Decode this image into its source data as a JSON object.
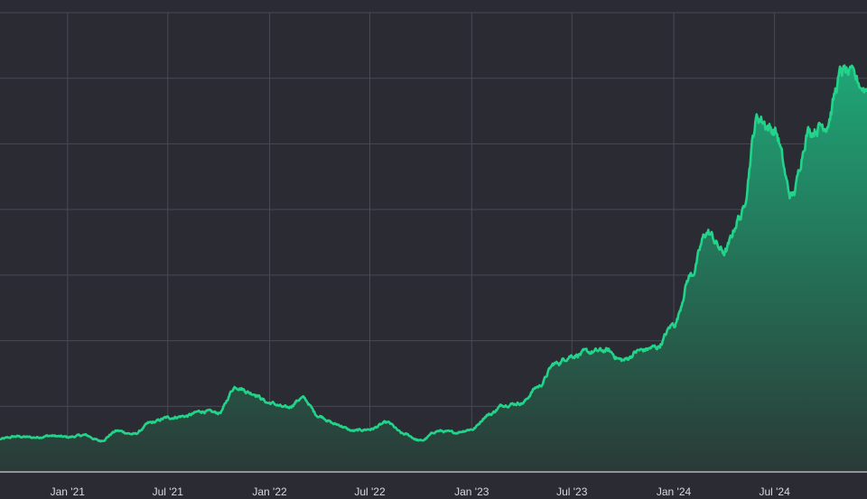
{
  "colors": {
    "background": "#2b2b33",
    "grid": "#4a4a55",
    "axis": "#cfcfd6",
    "line": "#22d48a",
    "fill_top": "#1fa677",
    "fill_bottom": "#2a3a36"
  },
  "chart_data": {
    "type": "area",
    "title": "",
    "xlabel": "",
    "ylabel": "",
    "x_ticks": [
      "Jan '21",
      "Jul '21",
      "Jan '22",
      "Jul '22",
      "Jan '23",
      "Jul '23",
      "Jan '24",
      "Jul '24"
    ],
    "x_range": [
      "2020-09-01",
      "2024-12-15"
    ],
    "ylim": [
      0,
      14
    ],
    "y_ticks": [
      0,
      2,
      4,
      6,
      8,
      10,
      12,
      14
    ],
    "y_ticks_labeled": false,
    "grid": true,
    "legend": "none",
    "series": [
      {
        "points": [
          [
            "2020-09-01",
            1.0
          ],
          [
            "2020-10-01",
            1.08
          ],
          [
            "2020-11-01",
            1.05
          ],
          [
            "2020-12-01",
            1.1
          ],
          [
            "2021-01-01",
            1.06
          ],
          [
            "2021-02-01",
            1.12
          ],
          [
            "2021-03-01",
            0.95
          ],
          [
            "2021-04-01",
            1.25
          ],
          [
            "2021-05-01",
            1.15
          ],
          [
            "2021-06-01",
            1.5
          ],
          [
            "2021-07-01",
            1.65
          ],
          [
            "2021-08-01",
            1.7
          ],
          [
            "2021-09-01",
            1.85
          ],
          [
            "2021-10-01",
            1.8
          ],
          [
            "2021-11-01",
            2.6
          ],
          [
            "2021-12-01",
            2.4
          ],
          [
            "2022-01-01",
            2.1
          ],
          [
            "2022-02-01",
            1.95
          ],
          [
            "2022-03-01",
            2.25
          ],
          [
            "2022-04-01",
            1.7
          ],
          [
            "2022-05-01",
            1.45
          ],
          [
            "2022-06-01",
            1.25
          ],
          [
            "2022-07-01",
            1.3
          ],
          [
            "2022-08-01",
            1.5
          ],
          [
            "2022-09-01",
            1.15
          ],
          [
            "2022-10-01",
            0.95
          ],
          [
            "2022-11-01",
            1.25
          ],
          [
            "2022-12-01",
            1.2
          ],
          [
            "2023-01-01",
            1.3
          ],
          [
            "2023-02-01",
            1.75
          ],
          [
            "2023-03-01",
            2.05
          ],
          [
            "2023-04-01",
            2.1
          ],
          [
            "2023-05-01",
            2.6
          ],
          [
            "2023-06-01",
            3.3
          ],
          [
            "2023-07-01",
            3.55
          ],
          [
            "2023-08-01",
            3.65
          ],
          [
            "2023-09-01",
            3.7
          ],
          [
            "2023-10-01",
            3.4
          ],
          [
            "2023-11-01",
            3.7
          ],
          [
            "2023-12-01",
            3.8
          ],
          [
            "2024-01-01",
            4.5
          ],
          [
            "2024-02-01",
            6.0
          ],
          [
            "2024-03-01",
            7.3
          ],
          [
            "2024-04-01",
            6.7
          ],
          [
            "2024-05-01",
            7.8
          ],
          [
            "2024-06-01",
            10.8
          ],
          [
            "2024-07-01",
            10.4
          ],
          [
            "2024-08-01",
            8.4
          ],
          [
            "2024-09-01",
            10.4
          ],
          [
            "2024-10-01",
            10.6
          ],
          [
            "2024-11-01",
            12.2
          ],
          [
            "2024-12-15",
            11.7
          ]
        ]
      }
    ]
  }
}
